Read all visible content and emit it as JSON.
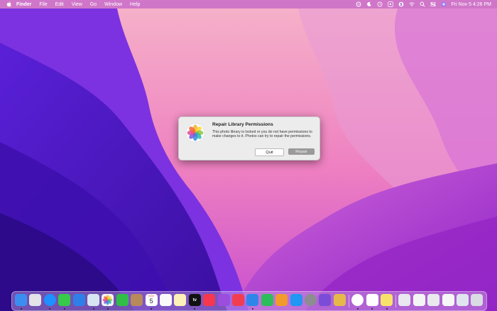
{
  "menubar": {
    "items": [
      "Finder",
      "File",
      "Edit",
      "View",
      "Go",
      "Window",
      "Help"
    ],
    "status_icons": [
      "sync-icon",
      "moon-icon",
      "clock-icon",
      "dots-icon",
      "dollar-icon",
      "wifi-icon",
      "search-icon",
      "control-center-icon",
      "siri-icon"
    ],
    "clock": "Fri Nov 5  4:26 PM"
  },
  "dialog": {
    "title": "Repair Library Permissions",
    "message": "This photo library is locked or you do not have permissions to make changes to it. Photos can try to repair the permissions.",
    "buttons": {
      "quit": "Quit",
      "repair": "Repair"
    }
  },
  "dock": {
    "calendar_day": "5",
    "calendar_month": "NOV",
    "tv_label": "tv",
    "apps": [
      {
        "name": "finder-icon",
        "color": "#3b8ef0"
      },
      {
        "name": "launchpad-icon",
        "color": "#e3e3e8"
      },
      {
        "name": "safari-icon",
        "color": "#1e90ff"
      },
      {
        "name": "messages-icon",
        "color": "#36c94a"
      },
      {
        "name": "mail-icon",
        "color": "#2f7fe8"
      },
      {
        "name": "preview-icon",
        "color": "#d7e6f2"
      },
      {
        "name": "photos-icon",
        "color": "#f3f3f3"
      },
      {
        "name": "facetime-icon",
        "color": "#2fbf47"
      },
      {
        "name": "contacts-icon",
        "color": "#b8895a"
      },
      {
        "name": "calendar-icon",
        "color": "#ffffff"
      },
      {
        "name": "reminders-icon",
        "color": "#fafafa"
      },
      {
        "name": "notes-icon",
        "color": "#fcf1b8"
      },
      {
        "name": "apple-tv-icon",
        "color": "#111111"
      },
      {
        "name": "music-icon",
        "color": "#f5384e"
      },
      {
        "name": "podcasts-icon",
        "color": "#9b4dde"
      },
      {
        "name": "news-icon",
        "color": "#f23d50"
      },
      {
        "name": "keynote-icon",
        "color": "#2f86e8"
      },
      {
        "name": "numbers-icon",
        "color": "#2ebd5b"
      },
      {
        "name": "pages-icon",
        "color": "#f29b2c"
      },
      {
        "name": "app-store-icon",
        "color": "#2196f3"
      },
      {
        "name": "system-preferences-icon",
        "color": "#8c8c92"
      },
      {
        "name": "feedback-icon",
        "color": "#7a4cd8"
      },
      {
        "name": "stickies-icon",
        "color": "#e6b84a"
      },
      {
        "name": "chrome-icon",
        "color": "#ffffff"
      },
      {
        "name": "slack-icon",
        "color": "#ffffff"
      },
      {
        "name": "sticky-notes-icon",
        "color": "#f7e36a"
      },
      {
        "name": "window-thumb-1-icon",
        "color": "#e8e8ee"
      },
      {
        "name": "window-thumb-2-icon",
        "color": "#f4f4f4"
      },
      {
        "name": "window-thumb-3-icon",
        "color": "#e9e9ee"
      },
      {
        "name": "window-thumb-4-icon",
        "color": "#f6f6f6"
      },
      {
        "name": "window-thumb-5-icon",
        "color": "#dfe6ef"
      },
      {
        "name": "trash-icon",
        "color": "#d9dde3"
      }
    ]
  },
  "colors": {
    "accent": "#a03cd2",
    "wallpaper_pink": "#f39ac0",
    "wallpaper_purple": "#5a16c8"
  }
}
